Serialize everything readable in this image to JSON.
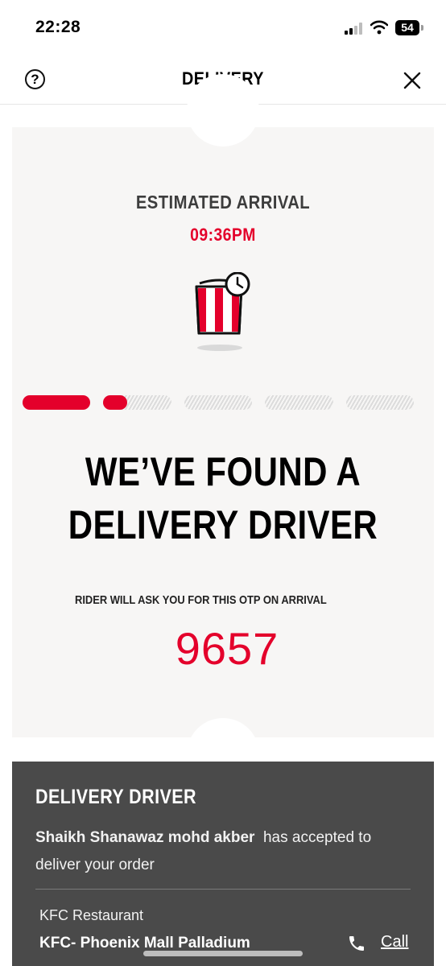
{
  "status_bar": {
    "time": "22:28",
    "battery": "54"
  },
  "header": {
    "title": "DELIVERY",
    "help_icon": "question-circle-icon",
    "close_icon": "close-icon"
  },
  "tracker": {
    "eta_label": "ESTIMATED ARRIVAL",
    "eta_time": "09:36PM",
    "illustration_icon": "kfc-bucket-clock-icon",
    "progress": {
      "total_steps": 5,
      "completed_steps": 1,
      "current_step_fill": 0.35
    },
    "headline": "WE’VE FOUND A DELIVERY DRIVER",
    "otp_label": "RIDER WILL ASK YOU FOR THIS OTP ON ARRIVAL",
    "otp_code": "9657"
  },
  "driver": {
    "title": "DELIVERY DRIVER",
    "name": "Shaikh Shanawaz mohd akber",
    "message": "has accepted to deliver your order",
    "restaurant_label": "KFC Restaurant",
    "restaurant_name": "KFC- Phoenix Mall Palladium",
    "call_label": "Call",
    "call_icon": "phone-icon"
  },
  "colors": {
    "accent": "#e4002b",
    "card_background": "#f7f6f5",
    "driver_panel": "#4a4a4a"
  }
}
